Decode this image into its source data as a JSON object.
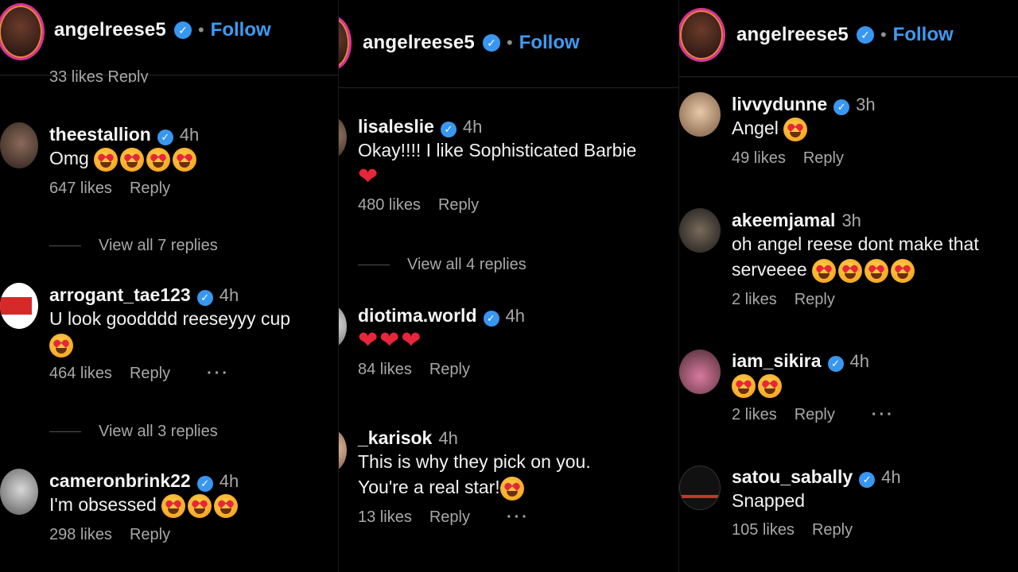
{
  "header": {
    "username": "angelreese5",
    "dot": "•",
    "follow": "Follow",
    "verified_icon": "verified-badge-icon"
  },
  "accent_colors": {
    "follow": "#3d9bf4",
    "verified": "#3897f0",
    "heart": "#e8263a"
  },
  "panel1": {
    "cutoff_meta": "33 likes   Reply",
    "comments": [
      {
        "user": "theestallion",
        "time": "4h",
        "text": "Omg",
        "likes": "647 likes",
        "reply": "Reply"
      },
      {
        "user": "arrogant_tae123",
        "time": "4h",
        "text": "U look goodddd reeseyyy cup",
        "likes": "464 likes",
        "reply": "Reply",
        "more": "···"
      },
      {
        "user": "cameronbrink22",
        "time": "4h",
        "text": "I'm obsessed",
        "likes": "298 likes",
        "reply": "Reply"
      }
    ],
    "view_replies": [
      "View all 7 replies",
      "View all 3 replies"
    ]
  },
  "panel2": {
    "comments": [
      {
        "user": "lisaleslie",
        "time": "4h",
        "text": "Okay!!!! I like Sophisticated Barbie",
        "likes": "480 likes",
        "reply": "Reply"
      },
      {
        "user": "diotima.world",
        "time": "4h",
        "text": "",
        "likes": "84 likes",
        "reply": "Reply"
      },
      {
        "user": "_karisok",
        "time": "4h",
        "text": "This is why they pick on you.",
        "text2": "You're a real star!",
        "likes": "13 likes",
        "reply": "Reply",
        "more": "···"
      }
    ],
    "view_replies": [
      "View all 4 replies"
    ]
  },
  "panel3": {
    "comments": [
      {
        "user": "livvydunne",
        "time": "3h",
        "text": "Angel",
        "likes": "49 likes",
        "reply": "Reply"
      },
      {
        "user": "akeemjamal",
        "time": "3h",
        "text": "oh angel reese dont make that",
        "text2": "serveeee",
        "likes": "2 likes",
        "reply": "Reply"
      },
      {
        "user": "iam_sikira",
        "time": "4h",
        "text": "",
        "likes": "2 likes",
        "reply": "Reply",
        "more": "···"
      },
      {
        "user": "satou_sabally",
        "time": "4h",
        "text": "Snapped",
        "likes": "105 likes",
        "reply": "Reply"
      }
    ]
  }
}
